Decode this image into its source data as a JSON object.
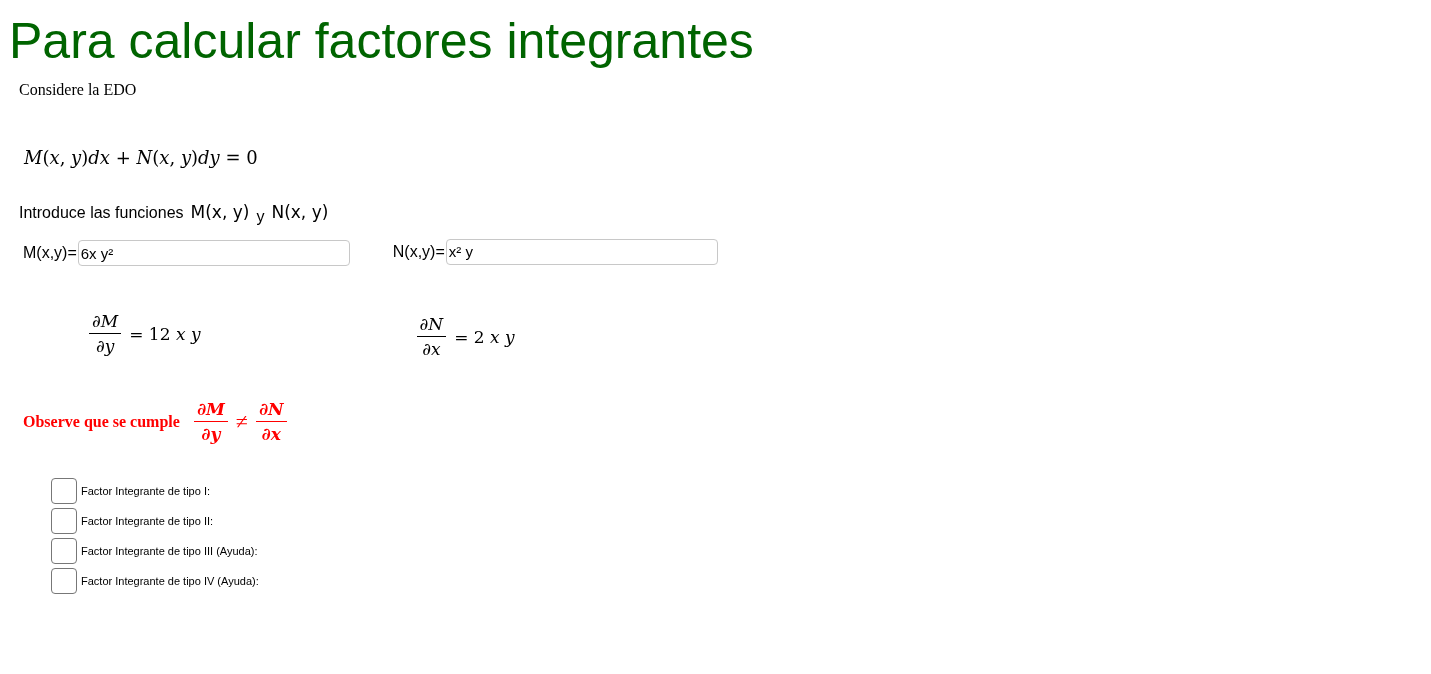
{
  "title": "Para calcular factores integrantes",
  "intro": "Considere la EDO",
  "equation": "*M*(*x*, *y*)*dx* + *N*(*x*, *y*)*dy* = 0",
  "prompt": {
    "text": "Introduce las funciones",
    "first": "M(x, y)",
    "joiner": "y",
    "second": "N(x, y)"
  },
  "inputs": [
    {
      "label": "M(x,y)=",
      "value": "6x y²"
    },
    {
      "label": "N(x,y)=",
      "value": "x² y"
    }
  ],
  "derivatives": [
    {
      "numerator": "∂*M*",
      "denominator": "∂*y*",
      "result": "= 12 *x* *y*"
    },
    {
      "numerator": "∂*N*",
      "denominator": "∂*x*",
      "result": "= 2 *x* *y*"
    }
  ],
  "observation": {
    "text": "Observe que se cumple",
    "left": {
      "numerator": "∂*M*",
      "denominator": "∂*y*"
    },
    "relation": "≠",
    "right": {
      "numerator": "∂*N*",
      "denominator": "∂*x*"
    }
  },
  "options": [
    {
      "label": "Factor Integrante de tipo I:",
      "checked": false
    },
    {
      "label": "Factor Integrante de tipo II:",
      "checked": false
    },
    {
      "label": "Factor Integrante de tipo III (Ayuda):",
      "checked": false
    },
    {
      "label": "Factor Integrante de tipo IV (Ayuda):",
      "checked": false
    }
  ]
}
